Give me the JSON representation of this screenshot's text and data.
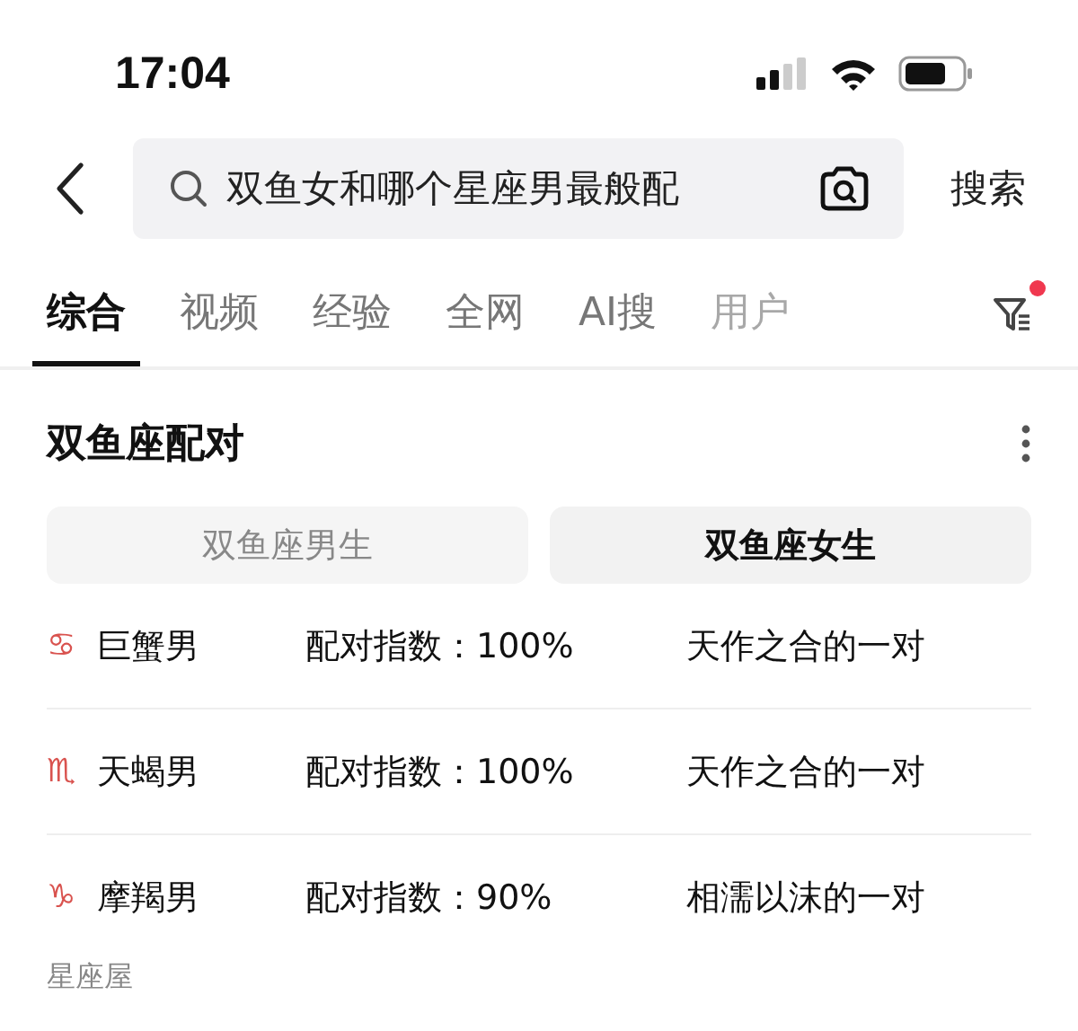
{
  "status_bar": {
    "time": "17:04"
  },
  "search": {
    "value": "双鱼女和哪个星座男最般配",
    "button": "搜索"
  },
  "tabs": [
    {
      "label": "综合",
      "selected": true,
      "faded": false
    },
    {
      "label": "视频",
      "selected": false,
      "faded": false
    },
    {
      "label": "经验",
      "selected": false,
      "faded": false
    },
    {
      "label": "全网",
      "selected": false,
      "faded": false
    },
    {
      "label": "AI搜",
      "selected": false,
      "faded": false
    },
    {
      "label": "用户",
      "selected": false,
      "faded": true
    }
  ],
  "filter": {
    "notice": true
  },
  "card": {
    "title": "双鱼座配对",
    "segments": [
      {
        "label": "双鱼座男生",
        "selected": false
      },
      {
        "label": "双鱼座女生",
        "selected": true
      }
    ],
    "rows": [
      {
        "symbol": "♋",
        "sign": "巨蟹男",
        "score": "配对指数：100%",
        "verdict": "天作之合的一对"
      },
      {
        "symbol": "♏",
        "sign": "天蝎男",
        "score": "配对指数：100%",
        "verdict": "天作之合的一对"
      },
      {
        "symbol": "♑",
        "sign": "摩羯男",
        "score": "配对指数：90%",
        "verdict": "相濡以沫的一对"
      }
    ],
    "source": "星座屋"
  }
}
